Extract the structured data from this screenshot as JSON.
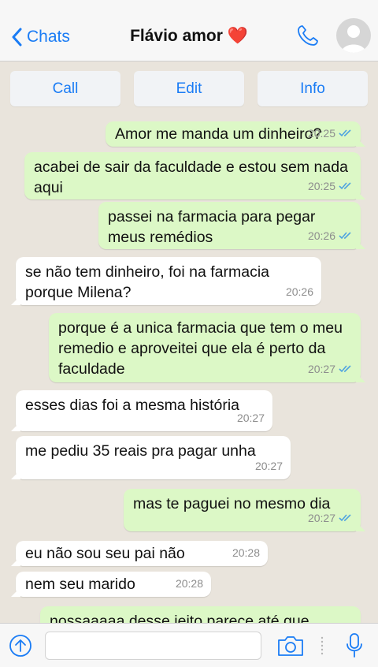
{
  "header": {
    "back_label": "Chats",
    "title": "Flávio amor ❤️"
  },
  "actions": {
    "call": "Call",
    "edit": "Edit",
    "info": "Info"
  },
  "messages": [
    {
      "dir": "out",
      "text": "Amor me manda um dinheiro?",
      "time": "20:25",
      "read": true
    },
    {
      "dir": "out",
      "text": "acabei de sair da faculdade e estou sem nada aqui",
      "time": "20:25",
      "read": true
    },
    {
      "dir": "out",
      "text": "passei na farmacia para pegar meus remédios",
      "time": "20:26",
      "read": true
    },
    {
      "dir": "in",
      "text": "se não tem dinheiro, foi na farmacia porque Milena?",
      "time": "20:26"
    },
    {
      "dir": "out",
      "text": "porque é a unica farmacia que tem o meu remedio e aproveitei que ela é perto da faculdade",
      "time": "20:27",
      "read": true
    },
    {
      "dir": "in",
      "text": "esses dias foi a mesma história",
      "time": "20:27"
    },
    {
      "dir": "in",
      "text": "me pediu 35 reais pra pagar unha",
      "time": "20:27"
    },
    {
      "dir": "out",
      "text": "mas te paguei no mesmo dia",
      "time": "20:27",
      "read": true
    },
    {
      "dir": "in",
      "text": "eu não sou seu pai não",
      "time": "20:28"
    },
    {
      "dir": "in",
      "text": "nem seu marido",
      "time": "20:28"
    },
    {
      "dir": "out",
      "text": "nossaaaaa desse jeito parece até que",
      "time": "",
      "read": false
    }
  ],
  "colors": {
    "accent": "#1a7cf5",
    "outgoing_bubble": "#dcf8c6",
    "incoming_bubble": "#ffffff",
    "background": "#e9e4dc",
    "read_ticks": "#4fa3e0"
  },
  "input": {
    "value": ""
  }
}
